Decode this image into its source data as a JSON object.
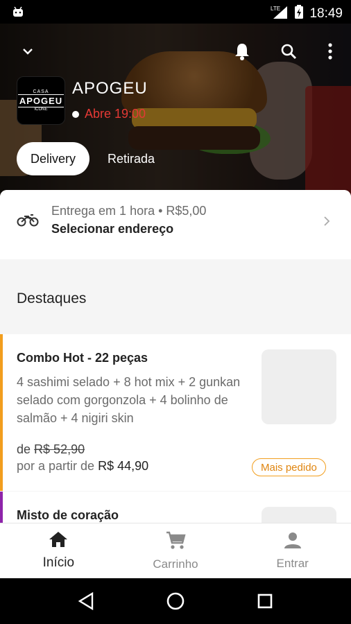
{
  "status_bar": {
    "time": "18:49",
    "network": "LTE",
    "icons": [
      "android-icon",
      "signal-icon",
      "battery-charging-icon"
    ]
  },
  "hero": {
    "icons": [
      "chevron-down-icon",
      "bell-icon",
      "search-icon",
      "more-vert-icon"
    ]
  },
  "store": {
    "logo": {
      "top": "CASA",
      "name": "APOGEU",
      "bottom": "ICONE"
    },
    "name": "APOGEU",
    "status": "Abre 19:00",
    "status_color": "#e53935"
  },
  "mode_tabs": {
    "delivery": "Delivery",
    "pickup": "Retirada"
  },
  "address": {
    "estimate": "Entrega em 1 hora • R$5,00",
    "action": "Selecionar endereço",
    "icon": "motorcycle-icon"
  },
  "section": {
    "title": "Destaques"
  },
  "items": [
    {
      "name": "Combo Hot - 22 peças",
      "description": "4 sashimi selado + 8 hot mix + 2 gunkan selado com gorgonzola + 4 bolinho de salmão + 4 nigiri skin",
      "old_price_prefix": "de",
      "old_price": "R$ 52,90",
      "price_prefix": "por a partir de",
      "price": "R$ 44,90",
      "badge": "Mais pedido",
      "accent": "#f29e1e"
    },
    {
      "name": "Misto de coração",
      "accent": "#8e24aa"
    }
  ],
  "bottom_nav": [
    {
      "label": "Início",
      "icon": "home-icon",
      "active": true
    },
    {
      "label": "Carrinho",
      "icon": "cart-icon",
      "active": false
    },
    {
      "label": "Entrar",
      "icon": "person-icon",
      "active": false
    }
  ],
  "android_nav": [
    "back-icon",
    "home-circle-icon",
    "recents-icon"
  ]
}
